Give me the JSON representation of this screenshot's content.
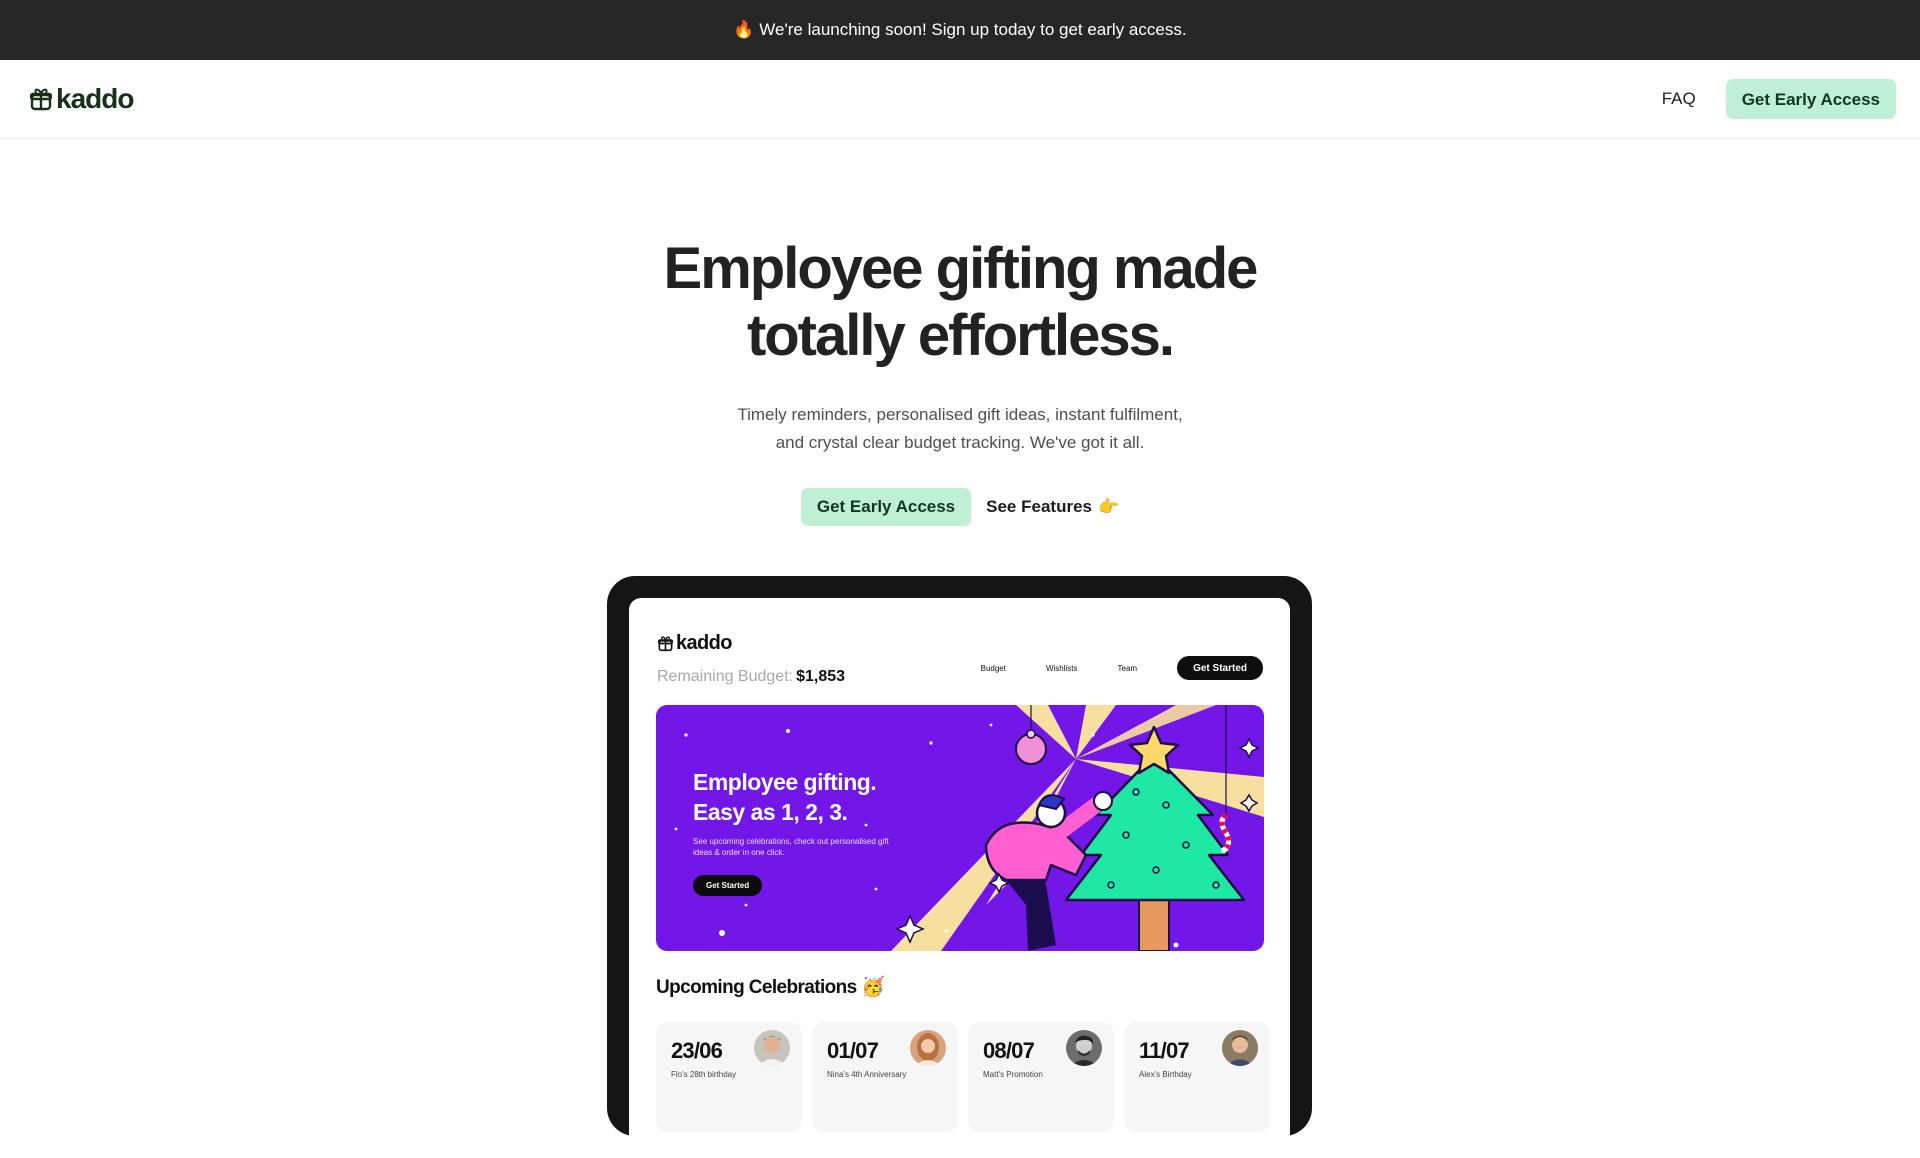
{
  "announcement": {
    "icon": "fire-icon",
    "text": "🔥 We're launching soon! Sign up today to get early access."
  },
  "nav": {
    "logo": "kaddo",
    "faq": "FAQ",
    "cta": "Get Early Access"
  },
  "hero": {
    "title_line1": "Employee gifting made",
    "title_line2": "totally effortless.",
    "subtitle_line1": "Timely reminders, personalised gift ideas, instant fulfilment,",
    "subtitle_line2": "and crystal clear budget tracking. We've got it all.",
    "cta_primary": "Get Early Access",
    "cta_secondary": "See Features",
    "cta_secondary_icon": "👉"
  },
  "app": {
    "logo": "kaddo",
    "budget_label": "Remaining Budget:",
    "budget_value": "$1,853",
    "nav": [
      "Budget",
      "Wishlists",
      "Team"
    ],
    "nav_cta": "Get Started",
    "banner": {
      "title_line1": "Employee gifting.",
      "title_line2": "Easy as 1, 2, 3.",
      "subtitle": "See upcoming celebrations, check out personalised gift ideas & order in one click.",
      "cta": "Get Started"
    },
    "upcoming_title": "Upcoming Celebrations",
    "upcoming_icon": "🥳",
    "celebrations": [
      {
        "date": "23/06",
        "label": "Flo's 28th birthday"
      },
      {
        "date": "01/07",
        "label": "Nina's 4th Anniversary"
      },
      {
        "date": "08/07",
        "label": "Matt's Promotion"
      },
      {
        "date": "11/07",
        "label": "Alex's Birthday"
      }
    ]
  },
  "colors": {
    "accent_green": "#bff0d3",
    "banner_purple": "#7316e8",
    "announcement_bg": "#262626"
  }
}
